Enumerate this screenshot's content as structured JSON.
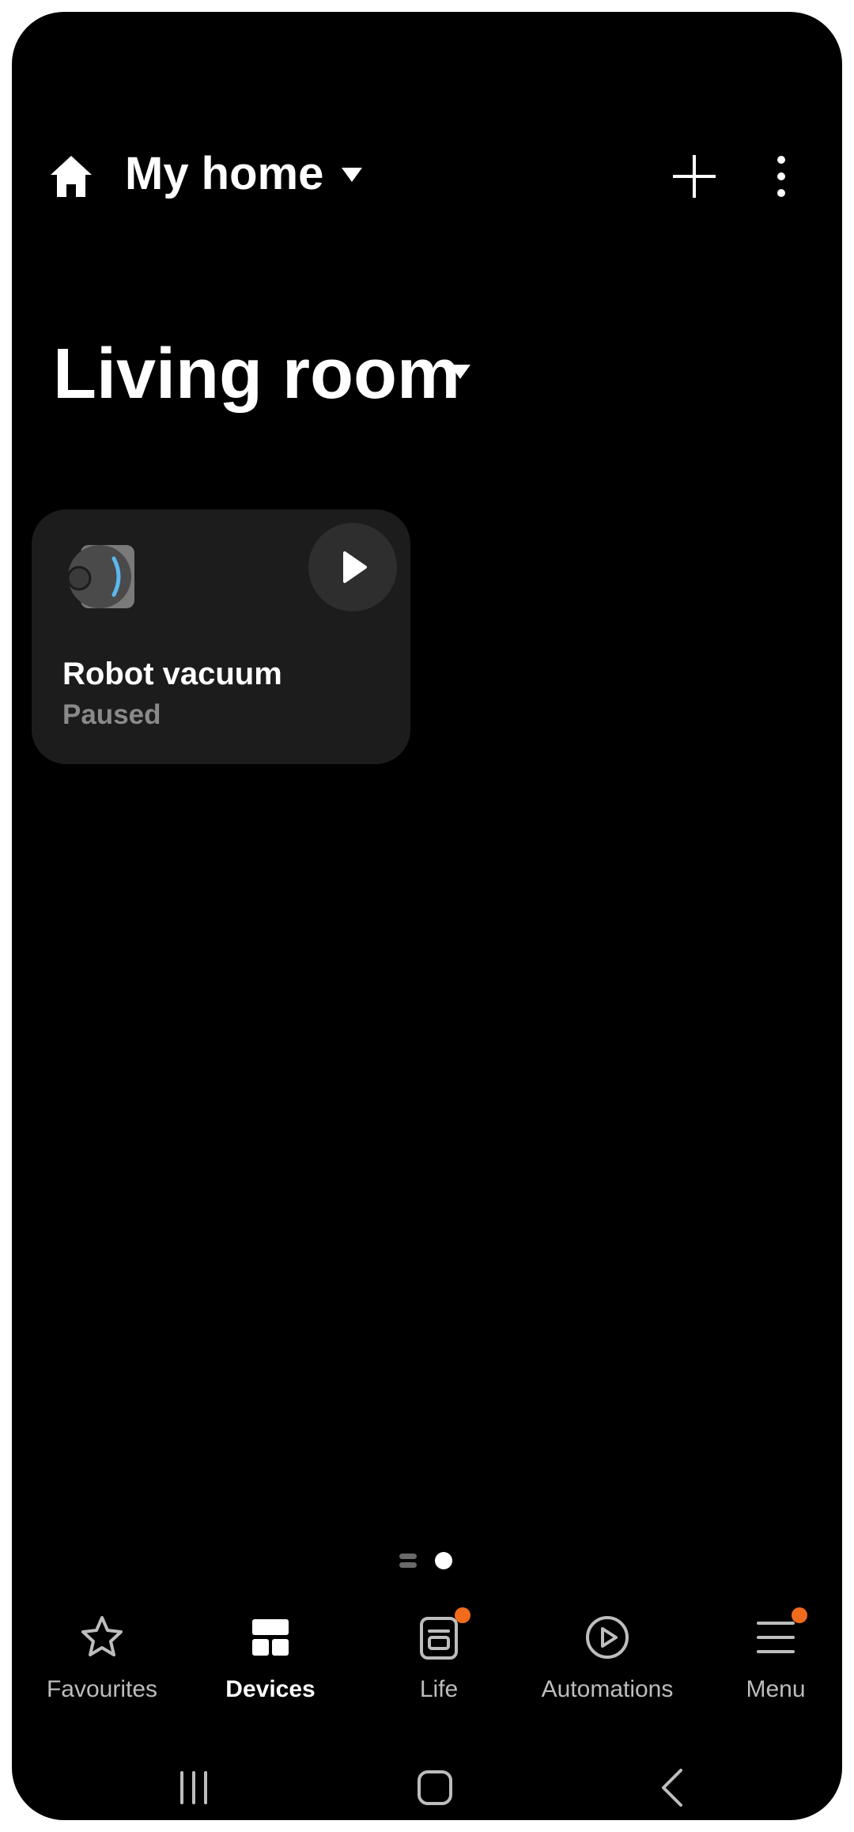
{
  "colors": {
    "background": "#000000",
    "card": "#1c1c1c",
    "badge": "#f26b1d",
    "vacuum_accent": "#5bb8f0",
    "inactive": "#bdbdbd",
    "active": "#ffffff"
  },
  "header": {
    "title": "My home",
    "home_icon": "home-icon",
    "caret_icon": "caret-down-icon",
    "add_icon": "plus-icon",
    "more_icon": "more-vertical-icon"
  },
  "room": {
    "title": "Living room",
    "caret_icon": "caret-down-icon"
  },
  "devices": [
    {
      "name": "Robot vacuum",
      "status": "Paused",
      "icon": "robot-vacuum-icon",
      "action_icon": "play-icon"
    }
  ],
  "page_indicator": {
    "pages": 2,
    "current": 2
  },
  "bottom_nav": {
    "items": [
      {
        "label": "Favourites",
        "icon": "star-icon",
        "active": false,
        "badge": false
      },
      {
        "label": "Devices",
        "icon": "devices-grid-icon",
        "active": true,
        "badge": false
      },
      {
        "label": "Life",
        "icon": "life-icon",
        "active": false,
        "badge": true
      },
      {
        "label": "Automations",
        "icon": "automations-play-icon",
        "active": false,
        "badge": false
      },
      {
        "label": "Menu",
        "icon": "menu-icon",
        "active": false,
        "badge": true
      }
    ]
  },
  "system_nav": {
    "recents_icon": "recents-icon",
    "home_icon": "home-outline-icon",
    "back_icon": "back-icon"
  }
}
